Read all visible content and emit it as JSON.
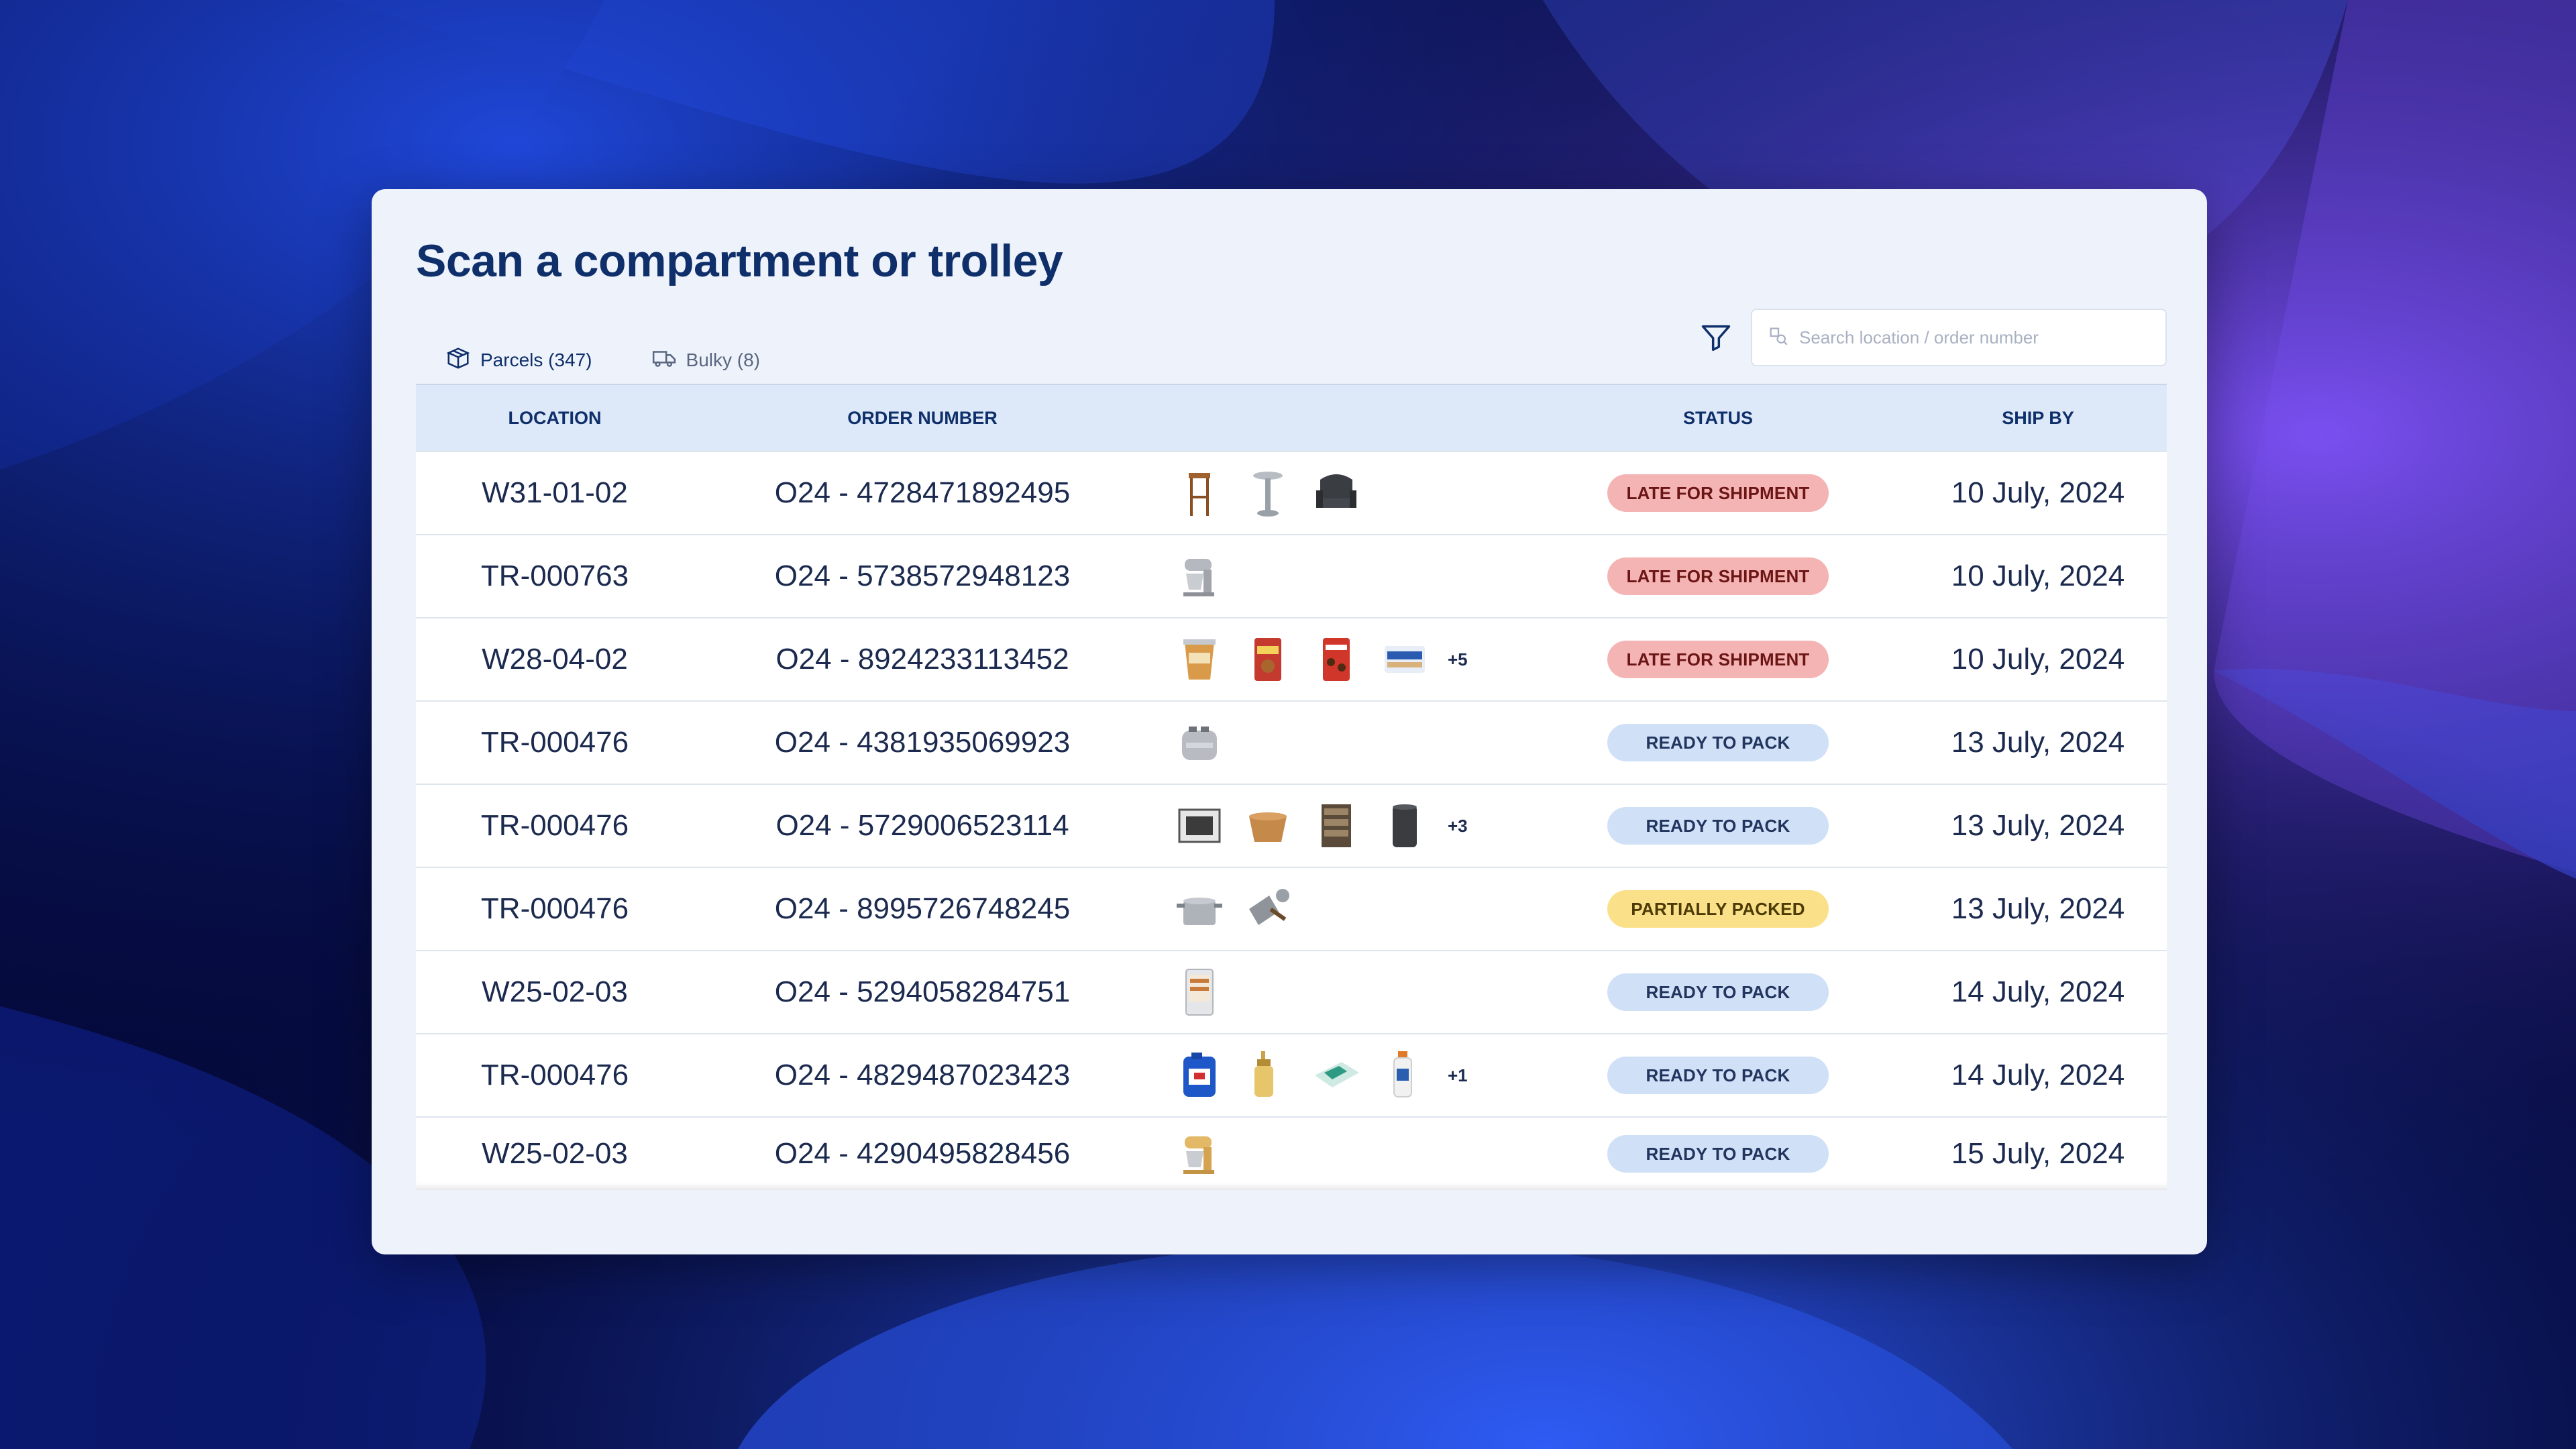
{
  "page": {
    "title": "Scan a compartment or trolley"
  },
  "tabs": [
    {
      "label": "Parcels (347)",
      "icon": "box-icon",
      "active": true
    },
    {
      "label": "Bulky (8)",
      "icon": "truck-icon",
      "active": false
    }
  ],
  "search": {
    "placeholder": "Search location / order number",
    "value": ""
  },
  "table": {
    "headers": {
      "location": "LOCATION",
      "order_number": "ORDER NUMBER",
      "items": "",
      "status": "STATUS",
      "ship_by": "SHIP BY"
    },
    "rows": [
      {
        "location": "W31-01-02",
        "order": "O24 - 4728471892495",
        "items": [
          "bar-stool",
          "pedestal-table",
          "armchair"
        ],
        "more": "",
        "status": "LATE FOR SHIPMENT",
        "status_kind": "late",
        "ship_by": "10 July, 2024"
      },
      {
        "location": "TR-000763",
        "order": "O24 - 5738572948123",
        "items": [
          "stand-mixer"
        ],
        "more": "",
        "status": "LATE FOR SHIPMENT",
        "status_kind": "late",
        "ship_by": "10 July, 2024"
      },
      {
        "location": "W28-04-02",
        "order": "O24 - 8924233113452",
        "items": [
          "snack-tub",
          "cookie-bag",
          "chocolate-bag",
          "wafer-pack"
        ],
        "more": "+5",
        "status": "LATE FOR SHIPMENT",
        "status_kind": "late",
        "ship_by": "10 July, 2024"
      },
      {
        "location": "TR-000476",
        "order": "O24 - 4381935069923",
        "items": [
          "toaster"
        ],
        "more": "",
        "status": "READY TO PACK",
        "status_kind": "ready",
        "ship_by": "13 July, 2024"
      },
      {
        "location": "TR-000476",
        "order": "O24 - 5729006523114",
        "items": [
          "photo-frame",
          "bowl",
          "shelf-unit",
          "bin"
        ],
        "more": "+3",
        "status": "READY TO PACK",
        "status_kind": "ready",
        "ship_by": "13 July, 2024"
      },
      {
        "location": "TR-000476",
        "order": "O24 - 8995726748245",
        "items": [
          "cooking-pot",
          "dustpan"
        ],
        "more": "",
        "status": "PARTIALLY PACKED",
        "status_kind": "partial",
        "ship_by": "13 July, 2024"
      },
      {
        "location": "W25-02-03",
        "order": "O24 - 5294058284751",
        "items": [
          "mini-fridge"
        ],
        "more": "",
        "status": "READY TO PACK",
        "status_kind": "ready",
        "ship_by": "14 July, 2024"
      },
      {
        "location": "TR-000476",
        "order": "O24 - 4829487023423",
        "items": [
          "detergent-can",
          "soap-bottle",
          "wipes-pack",
          "spray-bottle"
        ],
        "more": "+1",
        "status": "READY TO PACK",
        "status_kind": "ready",
        "ship_by": "14 July, 2024"
      },
      {
        "location": "W25-02-03",
        "order": "O24 - 4290495828456",
        "items": [
          "stand-mixer-gold"
        ],
        "more": "",
        "status": "READY TO PACK",
        "status_kind": "ready",
        "ship_by": "15 July, 2024"
      }
    ]
  },
  "colors": {
    "brand": "#0f2f6b",
    "late": "#f5b4b4",
    "ready": "#cfe0f7",
    "partial": "#fbe08a"
  }
}
